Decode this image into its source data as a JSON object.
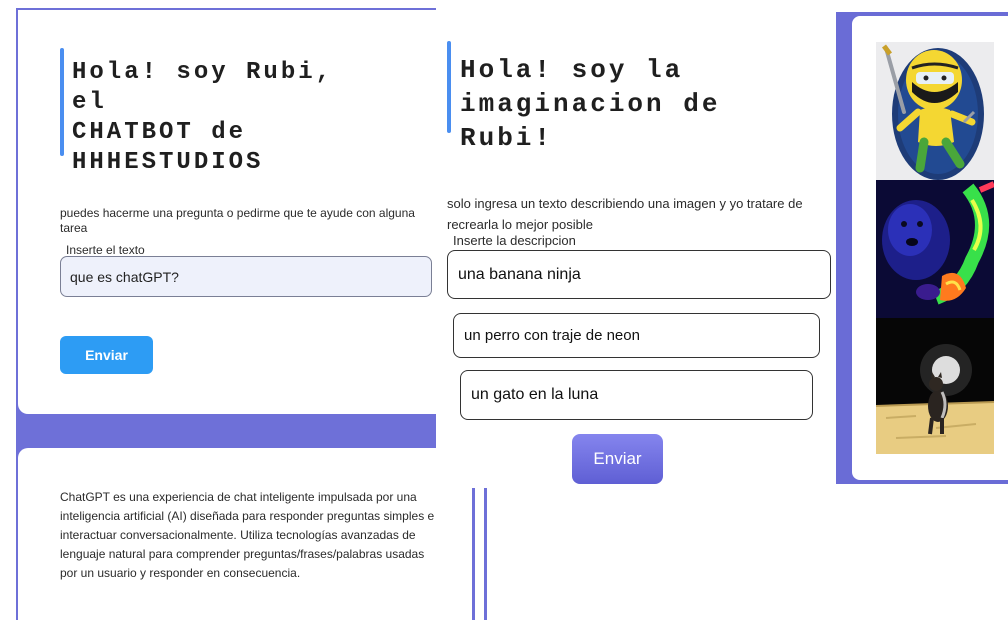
{
  "left_panel": {
    "title": "Hola! soy Rubi, el\nCHATBOT de\nHHHESTUDIOS",
    "description": "puedes hacerme una pregunta o pedirme que te ayude con alguna tarea",
    "input_label": "Inserte el texto",
    "input_value": "que es chatGPT?",
    "send_label": "Enviar",
    "answer": "ChatGPT es una experiencia de chat inteligente impulsada por una inteligencia artificial (AI) diseñada para responder preguntas simples e interactuar conversacionalmente. Utiliza tecnologías avanzadas de lenguaje natural para comprender preguntas/frases/palabras usadas por un usuario y responder en consecuencia."
  },
  "middle_panel": {
    "title": "Hola! soy la\nimaginacion de Rubi!",
    "description": "solo ingresa un texto describiendo una imagen y yo tratare de recrearla lo mejor posible",
    "input_label": "Inserte la descripcion",
    "input_value": "una banana ninja",
    "suggestions": [
      "un perro con traje de  neon",
      "un gato en la luna"
    ],
    "send_label": "Enviar"
  },
  "right_panel": {
    "images": [
      {
        "icon": "banana-ninja-image"
      },
      {
        "icon": "neon-dog-image"
      },
      {
        "icon": "cat-on-moon-image"
      }
    ]
  },
  "colors": {
    "accent_purple": "#6e70d8",
    "button_blue": "#2d9cf4",
    "title_bar_blue": "#4a8ef0",
    "button_violet": "#6f6fe0"
  }
}
